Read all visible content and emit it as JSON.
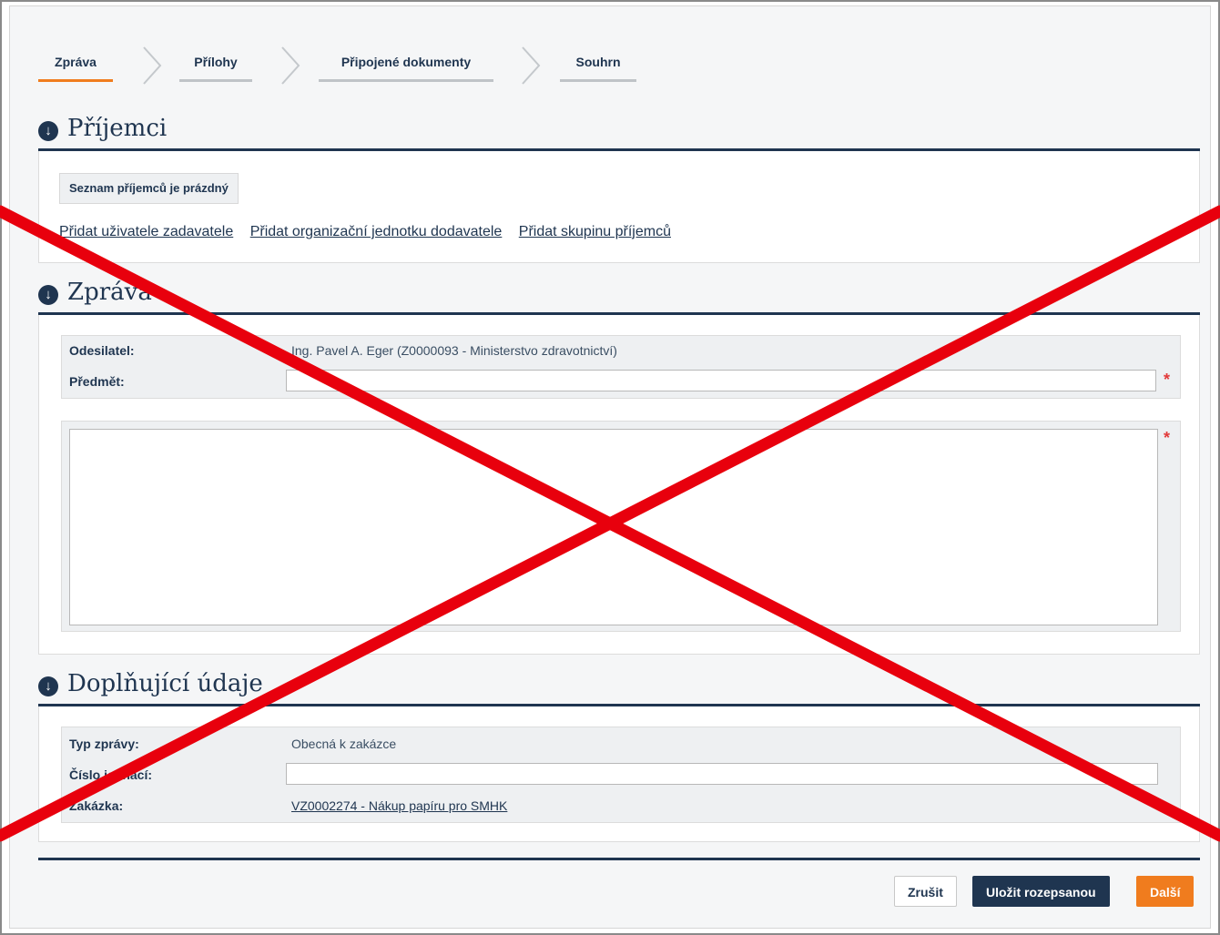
{
  "wizard": {
    "steps": [
      {
        "label": "Zpráva",
        "active": true
      },
      {
        "label": "Přílohy",
        "active": false
      },
      {
        "label": "Připojené dokumenty",
        "active": false
      },
      {
        "label": "Souhrn",
        "active": false
      }
    ]
  },
  "recipients": {
    "title": "Příjemci",
    "empty_text": "Seznam příjemců je prázdný",
    "links": [
      "Přidat uživatele zadavatele",
      "Přidat organizační jednotku dodavatele",
      "Přidat skupinu příjemců"
    ]
  },
  "message": {
    "title": "Zpráva",
    "sender_label": "Odesilatel:",
    "sender_value": "Ing. Pavel A. Eger (Z0000093 - Ministerstvo zdravotnictví)",
    "subject_label": "Předmět:",
    "subject_value": "",
    "body_value": "",
    "required_mark": "*"
  },
  "additional": {
    "title": "Doplňující údaje",
    "type_label": "Typ zprávy:",
    "type_value": "Obecná k zakázce",
    "number_label": "Číslo jednací:",
    "number_value": "",
    "order_label": "Zakázka:",
    "order_value": "VZ0002274 - Nákup papíru pro SMHK"
  },
  "buttons": {
    "cancel": "Zrušit",
    "save_draft": "Uložit rozepsanou",
    "next": "Další"
  },
  "colors": {
    "primary": "#1f3550",
    "accent": "#f07c1e",
    "required": "#e23a3a",
    "cross": "#e8000d"
  }
}
